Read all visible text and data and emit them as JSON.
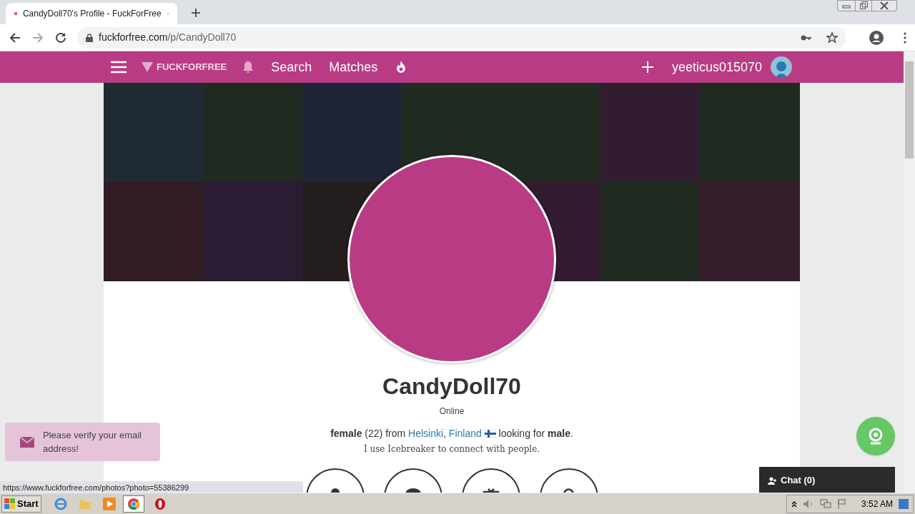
{
  "browser": {
    "tab_title": "CandyDoll70's Profile - FuckForFree",
    "url_host": "fuckforfree.com",
    "url_path": "/p/CandyDoll70",
    "status_url": "https://www.fuckforfree.com/photos?photo=55386299"
  },
  "nav": {
    "logo": "FUCKFORFREE",
    "links": [
      "Search",
      "Matches"
    ],
    "username": "yeeticus015070"
  },
  "profile": {
    "name": "CandyDoll70",
    "status": "Online",
    "details": [
      {
        "kind": "bold",
        "text": "female"
      },
      {
        "kind": "text",
        "text": " (22) from "
      },
      {
        "kind": "link",
        "text": "Helsinki"
      },
      {
        "kind": "text",
        "text": ", "
      },
      {
        "kind": "link",
        "text": "Finland"
      },
      {
        "kind": "flag"
      },
      {
        "kind": "text",
        "text": " looking for "
      },
      {
        "kind": "bold",
        "text": "male"
      },
      {
        "kind": "text",
        "text": "."
      }
    ],
    "bio": "I use Icebreaker to connect with people."
  },
  "toast": "Please verify your email address!",
  "chat": "Chat (0)",
  "taskbar": {
    "start": "Start",
    "clock": "3:52 AM"
  }
}
